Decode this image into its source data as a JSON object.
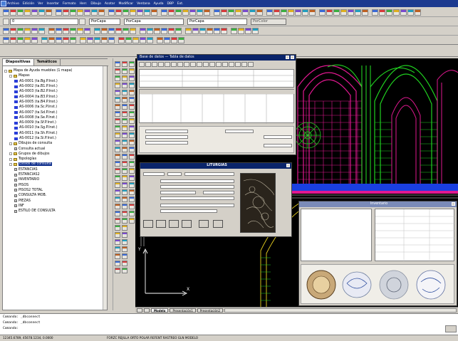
{
  "window": {
    "menus": [
      "Archivo",
      "Edición",
      "Ver",
      "Insertar",
      "Formato",
      "Herr.",
      "Dibujo",
      "Acotar",
      "Modificar",
      "Ventana",
      "Ayuda",
      "DBP",
      "Ext."
    ]
  },
  "toolbar2": {
    "layer_value": "0",
    "color_value": "PorCapa",
    "linetype_value": "PorCapa",
    "lineweight_value": "PorCapa",
    "plotstyle_value": "PorColor"
  },
  "left_panel": {
    "tabs": [
      "Diapositivas",
      "Temáticos"
    ],
    "tree": [
      {
        "level": 0,
        "icon": "folder",
        "label": "Mapa de Ayuda muebles (1 mapa)",
        "toggle": "-"
      },
      {
        "level": 1,
        "icon": "folder",
        "label": "Mapas",
        "toggle": "-"
      },
      {
        "level": 2,
        "icon": "drawing",
        "label": "AS-0001 (ta.Bg.P.Inst.)"
      },
      {
        "level": 2,
        "icon": "drawing",
        "label": "AS-0002 (ta.B1.P.Inst.)"
      },
      {
        "level": 2,
        "icon": "drawing",
        "label": "AS-0003 (ta.B2.P.Inst.)"
      },
      {
        "level": 2,
        "icon": "drawing",
        "label": "AS-0004 (ta.B3.P.Inst.)"
      },
      {
        "level": 2,
        "icon": "drawing",
        "label": "AS-0005 (ta.B4.P.Inst.)"
      },
      {
        "level": 2,
        "icon": "drawing",
        "label": "AS-0006 (ta.Sc.P.Inst.)"
      },
      {
        "level": 2,
        "icon": "drawing",
        "label": "AS-0007 (ta.Sd.P.Inst.)"
      },
      {
        "level": 2,
        "icon": "drawing",
        "label": "AS-0008 (ta.Se.P.Inst.)"
      },
      {
        "level": 2,
        "icon": "drawing",
        "label": "AS-0009 (ta.Sf.P.Inst.)"
      },
      {
        "level": 2,
        "icon": "drawing",
        "label": "AS-0010 (ta.Sg.P.Inst.)"
      },
      {
        "level": 2,
        "icon": "drawing",
        "label": "AS-0011 (ta.Sh.P.Inst.)"
      },
      {
        "level": 2,
        "icon": "drawing",
        "label": "AS-0012 (ta.Si.P.Inst.)"
      },
      {
        "level": 1,
        "icon": "folder",
        "label": "Dibujos de consulta",
        "toggle": "-"
      },
      {
        "level": 2,
        "icon": "ok",
        "label": "Consulta actual"
      },
      {
        "level": 1,
        "icon": "folder",
        "label": "Grupos de dibujos",
        "toggle": "+"
      },
      {
        "level": 1,
        "icon": "folder",
        "label": "Topologías",
        "toggle": "+"
      },
      {
        "level": 1,
        "icon": "folder",
        "label": "Estilos de consulta",
        "toggle": "-",
        "selected": true
      },
      {
        "level": 2,
        "icon": "style",
        "label": "ESTANCIAS"
      },
      {
        "level": 2,
        "icon": "style",
        "label": "ESTANCIAS2"
      },
      {
        "level": 2,
        "icon": "style",
        "label": "INVENTARIO"
      },
      {
        "level": 2,
        "icon": "style",
        "label": "PISOS"
      },
      {
        "level": 2,
        "icon": "style",
        "label": "PISOS2 TOTAL"
      },
      {
        "level": 2,
        "icon": "style",
        "label": "CONSULTA MOB."
      },
      {
        "level": 2,
        "icon": "style",
        "label": "PIEZAS"
      },
      {
        "level": 2,
        "icon": "style",
        "label": "INF"
      },
      {
        "level": 2,
        "icon": "style",
        "label": "ESTILO DE CONSULTA"
      }
    ]
  },
  "data_window": {
    "title": "Base de datos — Tabla de datos"
  },
  "image_window": {
    "title": "LITURGIAS"
  },
  "catalog_window": {
    "title": "Inventario"
  },
  "layout_tabs": {
    "items": [
      "Modelo",
      "Presentación1",
      "Presentación2"
    ]
  },
  "command": {
    "lines": [
      "Comando: _dbconnect",
      "Comando: _dbconnect",
      "Comando:"
    ]
  },
  "status": {
    "coords": "12345.6789, 45678.1234, 0.0000",
    "modes": "FORZC  REJILLA  ORTO  POLAR  REFENT  RASTREO  GLN  MODELO"
  },
  "colors": {
    "titlebar": "#1c3a8f",
    "canvas": "#000000",
    "tracery_magenta": "#e01890",
    "tracery_green": "#20d020",
    "tracery_blue": "#1a3fe0",
    "selection": "#0a2a8a"
  }
}
